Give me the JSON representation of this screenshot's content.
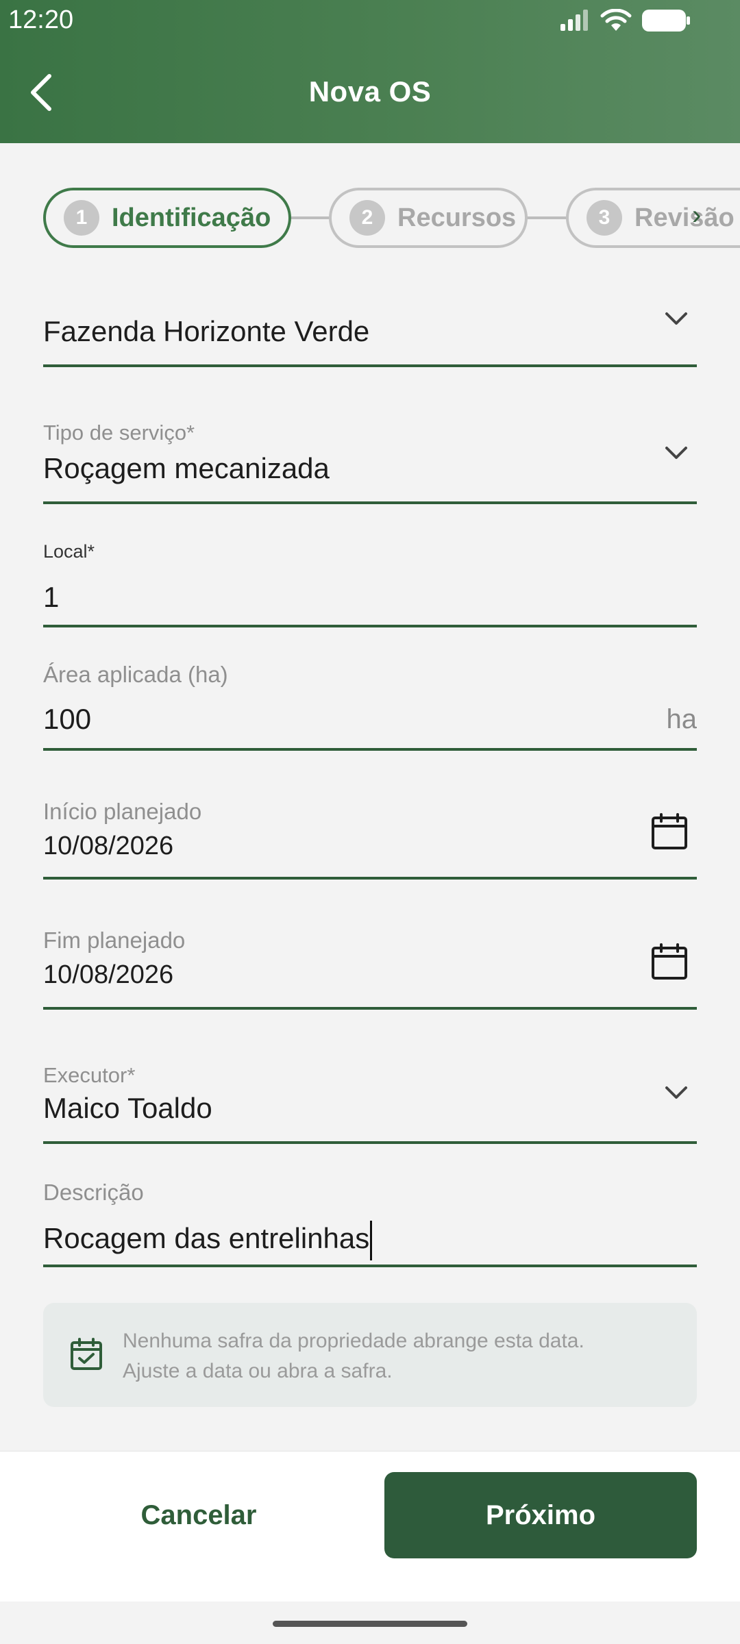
{
  "status_bar": {
    "time": "12:20"
  },
  "header": {
    "title": "Nova OS"
  },
  "stepper": {
    "steps": [
      {
        "number": "1",
        "label": "Identificação",
        "active": true
      },
      {
        "number": "2",
        "label": "Recursos",
        "active": false
      },
      {
        "number": "3",
        "label": "Revisão",
        "active": false
      }
    ]
  },
  "form": {
    "propriedade": {
      "value": "Fazenda Horizonte Verde"
    },
    "tipo_servico": {
      "label": "Tipo de serviço*",
      "value": "Roçagem mecanizada"
    },
    "local": {
      "label": "Local*",
      "value": "1"
    },
    "area": {
      "label": "Área aplicada (ha)",
      "value": "100",
      "suffix": "ha"
    },
    "inicio": {
      "label": "Início planejado",
      "value": "10/08/2026"
    },
    "fim": {
      "label": "Fim planejado",
      "value": "10/08/2026"
    },
    "executor": {
      "label": "Executor*",
      "value": "Maico Toaldo"
    },
    "descricao": {
      "label": "Descrição",
      "value": "Rocagem das entrelinhas"
    }
  },
  "info": {
    "line1": "Nenhuma safra da propriedade abrange esta data.",
    "line2": "Ajuste a data ou abra a safra."
  },
  "footer": {
    "cancel_label": "Cancelar",
    "next_label": "Próximo"
  },
  "colors": {
    "header": "#3a7344",
    "accent": "#2f5d39",
    "primary_button": "#2e5b3b"
  }
}
